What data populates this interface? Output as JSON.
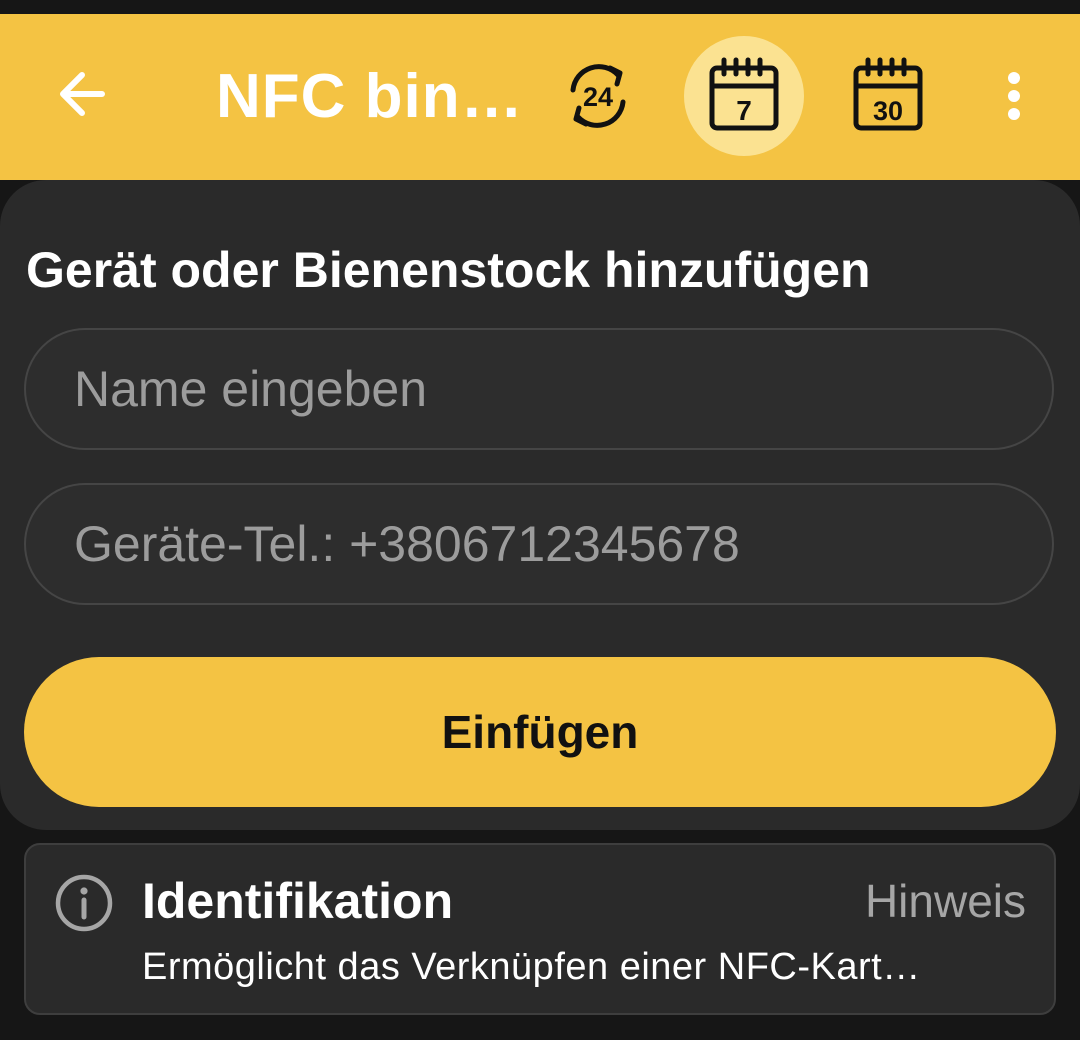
{
  "app_bar": {
    "title": "NFC bin…",
    "back_icon": "arrow-left-icon",
    "period_buttons": [
      {
        "label": "24",
        "icon": "24-hours-icon",
        "active": false
      },
      {
        "label": "7",
        "icon": "calendar-7-icon",
        "active": true
      },
      {
        "label": "30",
        "icon": "calendar-30-icon",
        "active": false
      }
    ],
    "more_icon": "more-vert-icon"
  },
  "form": {
    "title": "Gerät oder Bienenstock hinzufügen",
    "name_placeholder": "Name eingeben",
    "name_value": "",
    "phone_placeholder": "Geräte-Tel.: +3806712345678",
    "phone_value": "",
    "submit_label": "Einfügen"
  },
  "info": {
    "icon": "info-circle-icon",
    "title": "Identifikation",
    "hint_label": "Hinweis",
    "description": "Ermöglicht das Verknüpfen einer NFC-Kart…"
  },
  "colors": {
    "accent": "#F4C343",
    "accent_light": "#FBE291",
    "background": "#161616",
    "card": "#2A2A2A",
    "text_primary": "#FFFFFF",
    "text_secondary": "#9C9C9C"
  }
}
